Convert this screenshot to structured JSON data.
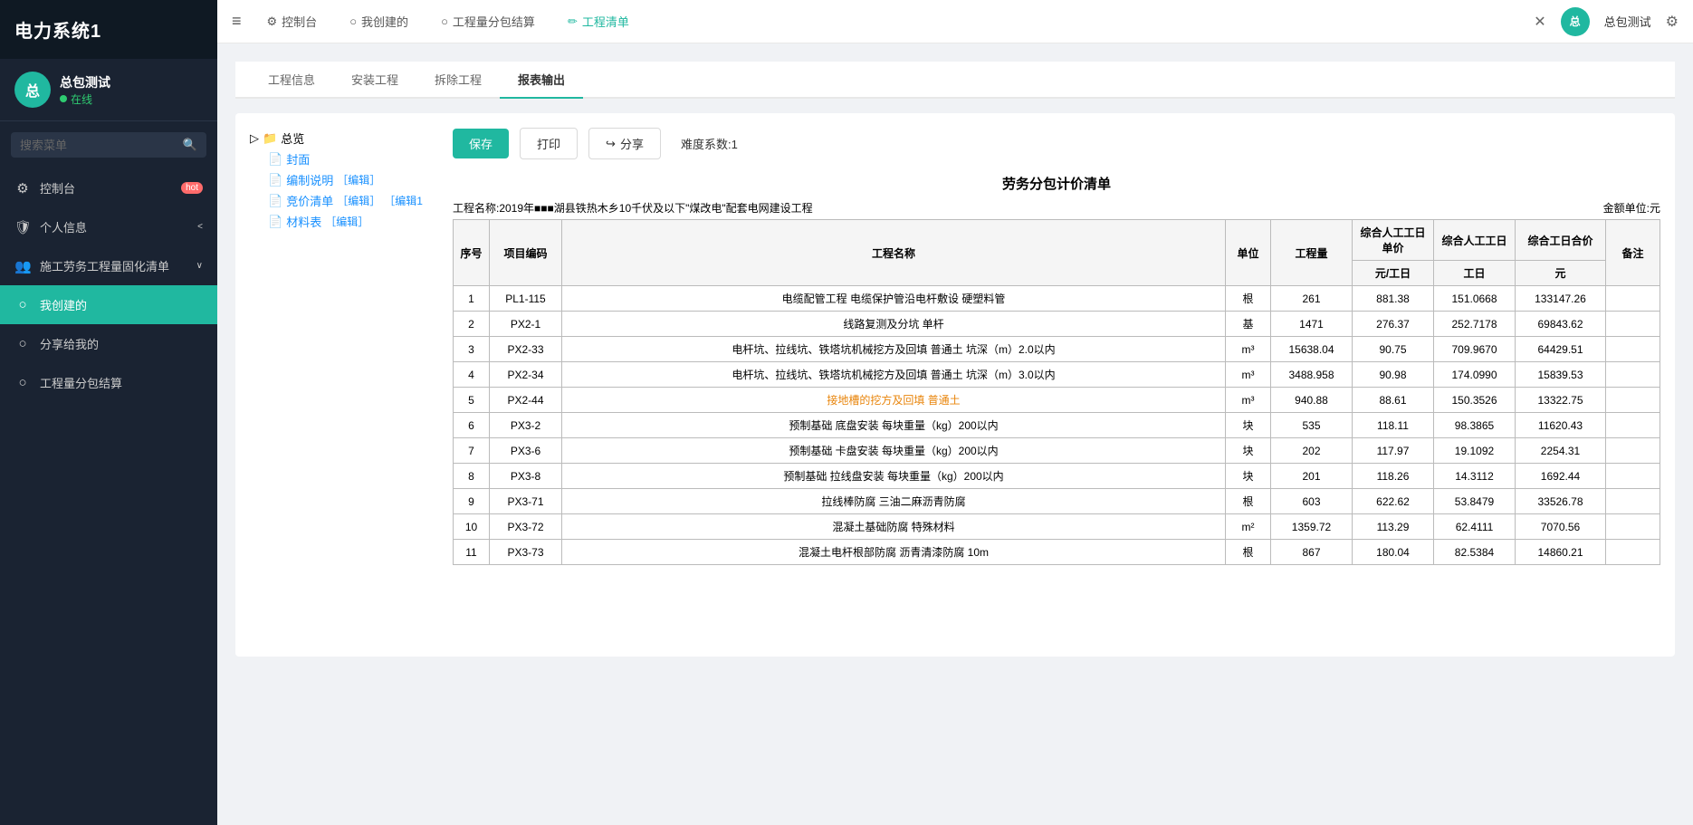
{
  "sidebar": {
    "title": "电力系统1",
    "user": {
      "avatar_text": "总",
      "name": "总包测试",
      "status": "在线"
    },
    "search_placeholder": "搜索菜单",
    "nav_items": [
      {
        "id": "dashboard",
        "label": "控制台",
        "icon": "⚙",
        "badge": "hot",
        "active": false
      },
      {
        "id": "personal",
        "label": "个人信息",
        "icon": "🛡",
        "arrow": "<",
        "active": false
      },
      {
        "id": "fixed-list",
        "label": "施工劳务工程量固化清单",
        "icon": "👥",
        "arrow": "∨",
        "active": false
      },
      {
        "id": "my-created",
        "label": "我创建的",
        "icon": "○",
        "active": true
      },
      {
        "id": "shared",
        "label": "分享给我的",
        "icon": "○",
        "active": false
      },
      {
        "id": "subcontract",
        "label": "工程量分包结算",
        "icon": "○",
        "active": false
      }
    ]
  },
  "topbar": {
    "menu_icon": "≡",
    "nav_items": [
      {
        "id": "dashboard",
        "label": "控制台",
        "icon": "⚙",
        "active": false
      },
      {
        "id": "my-created",
        "label": "我创建的",
        "icon": "○",
        "active": false
      },
      {
        "id": "subcontract",
        "label": "工程量分包结算",
        "icon": "○",
        "active": false
      },
      {
        "id": "project-list",
        "label": "工程清单",
        "icon": "✏",
        "active": true
      }
    ],
    "right": {
      "close_icon": "✕",
      "avatar_text": "总",
      "username": "总包测试",
      "settings_icon": "⚙"
    }
  },
  "tabs": [
    {
      "id": "project-info",
      "label": "工程信息",
      "active": false
    },
    {
      "id": "install-project",
      "label": "安装工程",
      "active": false
    },
    {
      "id": "demolish-project",
      "label": "拆除工程",
      "active": false
    },
    {
      "id": "report-output",
      "label": "报表输出",
      "active": true
    }
  ],
  "tree": {
    "root_label": "总览",
    "items": [
      {
        "id": "cover",
        "label": "封面",
        "type": "doc"
      },
      {
        "id": "compile-note",
        "label": "编制说明",
        "edit_label": "［编辑］",
        "type": "doc"
      },
      {
        "id": "quote-list",
        "label": "竞价清单",
        "edit_label": "［编辑］",
        "edit2_label": "［编辑1",
        "type": "doc"
      },
      {
        "id": "material-table",
        "label": "材料表",
        "edit_label": "［编辑］",
        "type": "doc"
      }
    ]
  },
  "actions": {
    "save_label": "保存",
    "print_label": "打印",
    "share_label": "分享",
    "difficulty_label": "难度系数:1"
  },
  "report": {
    "title": "劳务分包计价清单",
    "project_name": "工程名称:2019年■■■湖县铁热木乡10千伏及以下\"煤改电\"配套电网建设工程",
    "amount_unit": "金额单位:元",
    "columns": {
      "seq": "序号",
      "code": "项目编码",
      "name": "工程名称",
      "unit": "单位",
      "qty": "工程量",
      "unit_manday": "综合人工工日单价",
      "manday": "综合人工工日",
      "total": "综合工日合价",
      "remark": "备注"
    },
    "sub_headers": {
      "unit_manday": "元/工日",
      "manday": "工日",
      "total": "元"
    },
    "rows": [
      {
        "seq": "1",
        "code": "PL1-115",
        "name": "电缆配管工程 电缆保护管沿电杆敷设 硬塑料管",
        "unit": "根",
        "qty": "261",
        "unit_manday": "881.38",
        "manday": "151.0668",
        "total": "133147.26",
        "remark": "",
        "highlight": false
      },
      {
        "seq": "2",
        "code": "PX2-1",
        "name": "线路复测及分坑 单杆",
        "unit": "基",
        "qty": "1471",
        "unit_manday": "276.37",
        "manday": "252.7178",
        "total": "69843.62",
        "remark": "",
        "highlight": false
      },
      {
        "seq": "3",
        "code": "PX2-33",
        "name": "电杆坑、拉线坑、铁塔坑机械挖方及回填 普通土 坑深（m）2.0以内",
        "unit": "m³",
        "qty": "15638.04",
        "unit_manday": "90.75",
        "manday": "709.9670",
        "total": "64429.51",
        "remark": "",
        "highlight": false
      },
      {
        "seq": "4",
        "code": "PX2-34",
        "name": "电杆坑、拉线坑、铁塔坑机械挖方及回填 普通土 坑深（m）3.0以内",
        "unit": "m³",
        "qty": "3488.958",
        "unit_manday": "90.98",
        "manday": "174.0990",
        "total": "15839.53",
        "remark": "",
        "highlight": false
      },
      {
        "seq": "5",
        "code": "PX2-44",
        "name": "接地槽的挖方及回填 普通土",
        "unit": "m³",
        "qty": "940.88",
        "unit_manday": "88.61",
        "manday": "150.3526",
        "total": "13322.75",
        "remark": "",
        "highlight": true
      },
      {
        "seq": "6",
        "code": "PX3-2",
        "name": "预制基础 底盘安装 每块重量（kg）200以内",
        "unit": "块",
        "qty": "535",
        "unit_manday": "118.11",
        "manday": "98.3865",
        "total": "11620.43",
        "remark": "",
        "highlight": false
      },
      {
        "seq": "7",
        "code": "PX3-6",
        "name": "预制基础 卡盘安装 每块重量（kg）200以内",
        "unit": "块",
        "qty": "202",
        "unit_manday": "117.97",
        "manday": "19.1092",
        "total": "2254.31",
        "remark": "",
        "highlight": false
      },
      {
        "seq": "8",
        "code": "PX3-8",
        "name": "预制基础 拉线盘安装 每块重量（kg）200以内",
        "unit": "块",
        "qty": "201",
        "unit_manday": "118.26",
        "manday": "14.3112",
        "total": "1692.44",
        "remark": "",
        "highlight": false
      },
      {
        "seq": "9",
        "code": "PX3-71",
        "name": "拉线棒防腐 三油二麻沥青防腐",
        "unit": "根",
        "qty": "603",
        "unit_manday": "622.62",
        "manday": "53.8479",
        "total": "33526.78",
        "remark": "",
        "highlight": false
      },
      {
        "seq": "10",
        "code": "PX3-72",
        "name": "混凝土基础防腐 特殊材料",
        "unit": "m²",
        "qty": "1359.72",
        "unit_manday": "113.29",
        "manday": "62.4111",
        "total": "7070.56",
        "remark": "",
        "highlight": false
      },
      {
        "seq": "11",
        "code": "PX3-73",
        "name": "混凝土电杆根部防腐 沥青清漆防腐 10m",
        "unit": "根",
        "qty": "867",
        "unit_manday": "180.04",
        "manday": "82.5384",
        "total": "14860.21",
        "remark": "",
        "highlight": false
      }
    ]
  }
}
